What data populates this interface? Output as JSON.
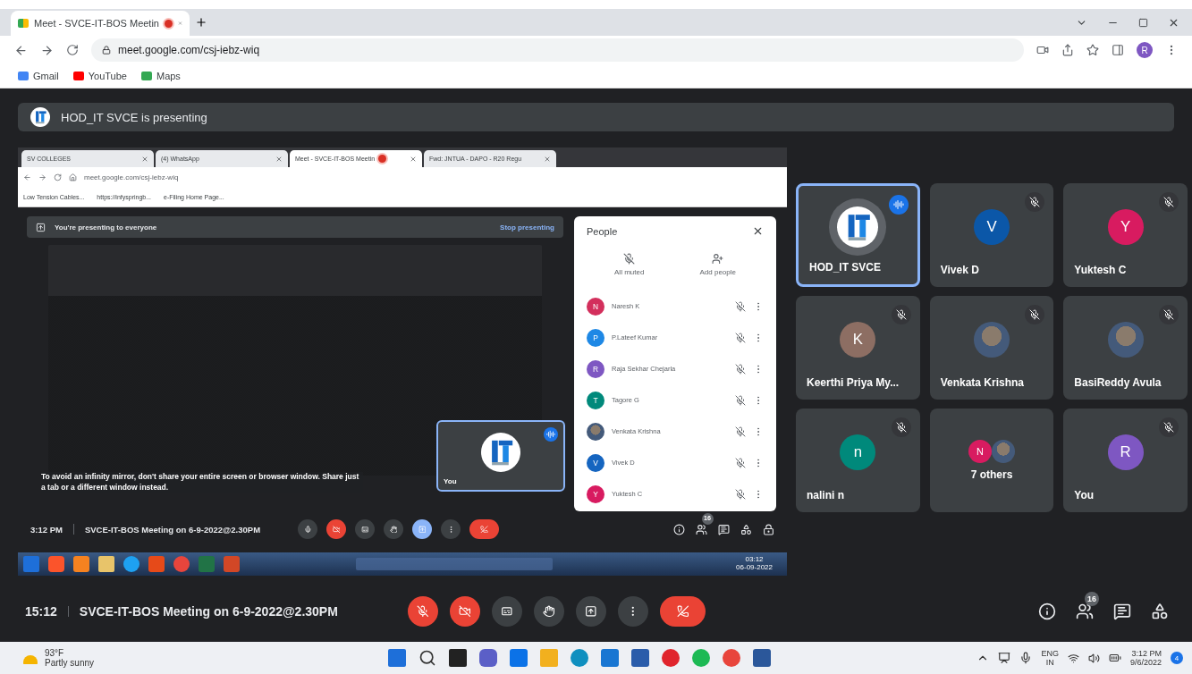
{
  "browser": {
    "tabs": [
      {
        "title": "Meet - SVCE-IT-BOS Meetin",
        "selected": true,
        "recording": true
      }
    ],
    "url": "meet.google.com/csj-iebz-wiq",
    "profile": "R",
    "bookmarks": [
      {
        "kind": "google",
        "label": "Gmail"
      },
      {
        "kind": "youtube",
        "label": "YouTube"
      },
      {
        "kind": "maps",
        "label": "Maps"
      }
    ]
  },
  "presenting_banner": "HOD_IT SVCE is presenting",
  "shared_screen": {
    "tabs": [
      {
        "title": "SV COLLEGES",
        "selected": false,
        "recording": false
      },
      {
        "title": "(4) WhatsApp",
        "selected": false,
        "recording": false
      },
      {
        "title": "Meet - SVCE-IT-BOS Meetin",
        "selected": true,
        "recording": true
      },
      {
        "title": "Fwd: JNTUA - DAPO - R20 Regu",
        "selected": false,
        "recording": false
      }
    ],
    "url": "meet.google.com/csj-iebz-wiq",
    "bookmarks": [
      "Low Tension Cables...",
      "https://infyspringb...",
      "e-Filing Home Page..."
    ],
    "banner": "You're presenting to everyone",
    "stop_button": "Stop presenting",
    "warning": "To avoid an infinity mirror, don't share your entire screen or browser window. Share just a tab or a different window instead.",
    "self_tile": {
      "name": "You",
      "speaking": true
    },
    "time": "3:12 PM",
    "meeting": "SVCE-IT-BOS Meeting on 6-9-2022@2.30PM",
    "controls": [
      {
        "kind": "mic",
        "off": false,
        "active": false
      },
      {
        "kind": "camera",
        "off": true,
        "active": false
      },
      {
        "kind": "captions",
        "off": false,
        "active": false
      },
      {
        "kind": "hand",
        "off": false,
        "active": false
      },
      {
        "kind": "present",
        "off": false,
        "active": true
      },
      {
        "kind": "more",
        "off": false,
        "active": false
      },
      {
        "kind": "leave",
        "off": true,
        "active": false
      }
    ],
    "side_icons": [
      {
        "kind": "info"
      },
      {
        "kind": "people",
        "badge": "16"
      },
      {
        "kind": "chat"
      },
      {
        "kind": "activities"
      },
      {
        "kind": "lock"
      }
    ],
    "people_panel": {
      "title": "People",
      "actions": [
        {
          "kind": "muted",
          "label": "All muted"
        },
        {
          "kind": "add",
          "label": "Add people"
        }
      ],
      "participants": [
        {
          "kind": "initial",
          "initial": "N",
          "color": "#d32f5c",
          "name": "Naresh K"
        },
        {
          "kind": "initial",
          "initial": "P",
          "color": "#1e88e5",
          "name": "P.Lateef Kumar"
        },
        {
          "kind": "initial",
          "initial": "R",
          "color": "#7e57c2",
          "name": "Raja Sekhar Chejarla"
        },
        {
          "kind": "initial",
          "initial": "T",
          "color": "#00897b",
          "name": "Tagore G"
        },
        {
          "kind": "photo",
          "name": "Venkata Krishna"
        },
        {
          "kind": "initial",
          "initial": "V",
          "color": "#1565c0",
          "name": "Vivek D"
        },
        {
          "kind": "initial",
          "initial": "Y",
          "color": "#d81b60",
          "name": "Yuktesh C"
        }
      ]
    },
    "taskbar_apps": [
      {
        "kind": "start"
      },
      {
        "kind": "brave"
      },
      {
        "kind": "media"
      },
      {
        "kind": "files"
      },
      {
        "kind": "ie"
      },
      {
        "kind": "office"
      },
      {
        "kind": "chrome"
      },
      {
        "kind": "excel"
      },
      {
        "kind": "powerpoint"
      }
    ],
    "taskbar_clock": [
      "03:12",
      "06-09-2022"
    ]
  },
  "tiles": [
    {
      "kind": "logo",
      "name": "HOD_IT SVCE",
      "speaking": true,
      "muted": false
    },
    {
      "kind": "initial",
      "initial": "V",
      "color": "#0b57a8",
      "name": "Vivek D",
      "speaking": false,
      "muted": true
    },
    {
      "kind": "initial",
      "initial": "Y",
      "color": "#d81b60",
      "name": "Yuktesh C",
      "speaking": false,
      "muted": true
    },
    {
      "kind": "initial",
      "initial": "K",
      "color": "#8d6e63",
      "name": "Keerthi Priya My...",
      "speaking": false,
      "muted": true
    },
    {
      "kind": "photo",
      "name": "Venkata Krishna",
      "speaking": false,
      "muted": true
    },
    {
      "kind": "photo",
      "name": "BasiReddy Avula",
      "speaking": false,
      "muted": true
    },
    {
      "kind": "initial",
      "initial": "n",
      "color": "#00897b",
      "name": "nalini n",
      "speaking": false,
      "muted": true
    },
    {
      "kind": "group",
      "initial": "N",
      "color": "#d81b60",
      "name": "7 others",
      "speaking": false,
      "muted": false
    },
    {
      "kind": "initial",
      "initial": "R",
      "color": "#7e57c2",
      "name": "You",
      "speaking": false,
      "muted": true
    }
  ],
  "bottom_bar": {
    "time": "15:12",
    "meeting": "SVCE-IT-BOS Meeting on 6-9-2022@2.30PM",
    "controls": [
      {
        "kind": "mic",
        "off": true,
        "active": false
      },
      {
        "kind": "camera",
        "off": true,
        "active": false
      },
      {
        "kind": "captions",
        "off": false,
        "active": false
      },
      {
        "kind": "hand",
        "off": false,
        "active": false
      },
      {
        "kind": "present",
        "off": false,
        "active": false
      },
      {
        "kind": "more",
        "off": false,
        "active": false
      },
      {
        "kind": "leave",
        "off": true,
        "active": false
      }
    ],
    "side_icons": [
      {
        "kind": "info"
      },
      {
        "kind": "people",
        "badge": "16"
      },
      {
        "kind": "chat"
      },
      {
        "kind": "activities"
      }
    ]
  },
  "taskbar": {
    "weather": {
      "temp": "93°F",
      "desc": "Partly sunny"
    },
    "apps": [
      {
        "kind": "start"
      },
      {
        "kind": "search"
      },
      {
        "kind": "taskview"
      },
      {
        "kind": "meet"
      },
      {
        "kind": "zoom"
      },
      {
        "kind": "explorer"
      },
      {
        "kind": "edge"
      },
      {
        "kind": "launcher"
      },
      {
        "kind": "store"
      },
      {
        "kind": "opera"
      },
      {
        "kind": "spotify"
      },
      {
        "kind": "chrome"
      },
      {
        "kind": "word"
      }
    ],
    "lang": "ENG",
    "region": "IN",
    "time": "3:12 PM",
    "date": "9/6/2022",
    "notifications": "4"
  }
}
